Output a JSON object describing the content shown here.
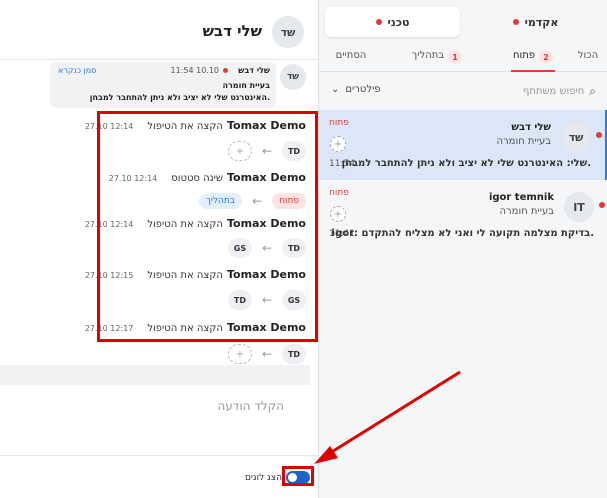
{
  "right_panel": {
    "top_tabs": [
      {
        "label": "טכני"
      },
      {
        "label": "אקדמי"
      }
    ],
    "sub_tabs": [
      {
        "label": "הסתיים"
      },
      {
        "label": "בתהליך",
        "count": "1"
      },
      {
        "label": "פתוח",
        "count": "2"
      },
      {
        "label": "הכול"
      }
    ],
    "filters_label": "פילטרים",
    "search_placeholder": "חיפוש משתתף",
    "tickets": [
      {
        "avatar": "שד",
        "name": "שלי דבש",
        "subject": "בעיית חומרה",
        "message": "שלי: האינטרנט שלי לא יציב ולא ניתן להתחבר למבחן.",
        "status": "פתוח",
        "time": "11:54"
      },
      {
        "avatar": "IT",
        "name": "igor temnik",
        "subject": "בעיית חומרה",
        "message": "igor: בדיקת מצלמה תקועה לי ואני לא מצליח להתקדם.",
        "status": "פתוח",
        "time": "11:41"
      }
    ]
  },
  "conversation": {
    "header": {
      "avatar": "שד",
      "title": "שלי דבש"
    },
    "first_message": {
      "avatar": "שד",
      "author": "שלי דבש",
      "time": "11:54 10.10",
      "mark_unread": "סמן כנקרא",
      "subject": "בעיית חומרה",
      "body": "האינטרנט שלי לא יציב ולא ניתן להתחבר למבחן."
    },
    "events": [
      {
        "who": "Tomax Demo",
        "action": "הקצה את הטיפול",
        "when": "12:14 27.10",
        "from": "+",
        "to": "TD"
      },
      {
        "who": "Tomax Demo",
        "action": "שינה סטטוס",
        "when": "12:14 27.10",
        "from": "פתוח",
        "to": "בתהליך"
      },
      {
        "who": "Tomax Demo",
        "action": "הקצה את הטיפול",
        "when": "12:14 27.10",
        "from": "TD",
        "to": "GS"
      },
      {
        "who": "Tomax Demo",
        "action": "הקצה את הטיפול",
        "when": "12:15 27.10",
        "from": "GS",
        "to": "TD"
      },
      {
        "who": "Tomax Demo",
        "action": "הקצה את הטיפול",
        "when": "12:17 27.10",
        "from": "TD",
        "to": "+"
      }
    ],
    "compose_placeholder": "הקלד הודעה",
    "show_logs_label": "הצג לוגים"
  },
  "colors": {
    "accent_red": "#e53935",
    "accent_blue": "#2e7ad6",
    "annotation_red": "#e00000"
  }
}
